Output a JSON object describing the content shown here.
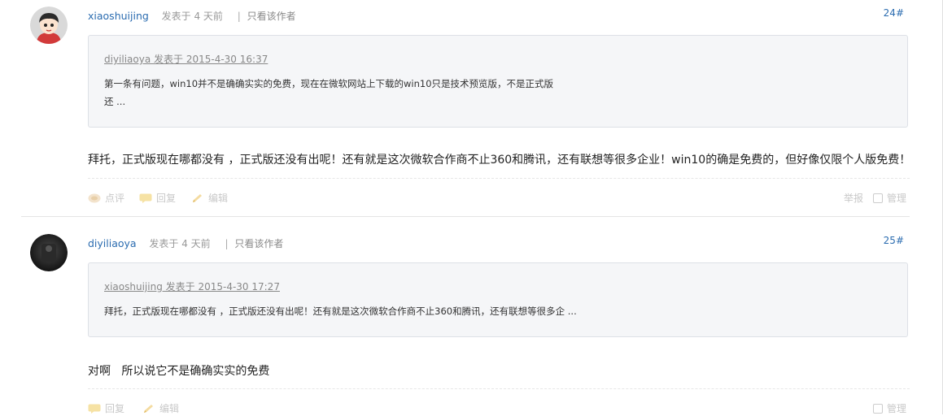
{
  "posts": [
    {
      "author": "xiaoshuijing",
      "time": "发表于 4 天前",
      "sep": "|",
      "only_author": "只看该作者",
      "floor": "24#",
      "quote": {
        "head": "diyiliaoya 发表于 2015-4-30 16:37",
        "line1": "第一条有问题，win10并不是确确实实的免费，现在在微软网站上下载的win10只是技术预览版，不是正式版",
        "line2": "还 ..."
      },
      "content": "拜托，正式版现在哪都没有 ，正式版还没有出呢！还有就是这次微软合作商不止360和腾讯，还有联想等很多企业！win10的确是免费的，但好像仅限个人版免费！",
      "actions": {
        "comment": "点评",
        "reply": "回复",
        "edit": "编辑",
        "report": "举报",
        "manage": "管理"
      }
    },
    {
      "author": "diyiliaoya",
      "time": "发表于 4 天前",
      "sep": "|",
      "only_author": "只看该作者",
      "floor": "25#",
      "quote": {
        "head": "xiaoshuijing 发表于 2015-4-30 17:27",
        "line1": "拜托，正式版现在哪都没有 ，正式版还没有出呢！还有就是这次微软合作商不止360和腾讯，还有联想等很多企 ..."
      },
      "content": "对啊   所以说它不是确确实实的免费",
      "actions": {
        "reply": "回复",
        "edit": "编辑",
        "manage": "管理"
      }
    }
  ],
  "colors": {
    "link": "#2b6cb0",
    "quote_bg": "#f5f6f8",
    "muted": "#c8c8c8"
  },
  "icons": [
    "avatar-cartoon",
    "avatar-dark",
    "comment-icon",
    "reply-icon",
    "edit-icon",
    "checkbox"
  ]
}
